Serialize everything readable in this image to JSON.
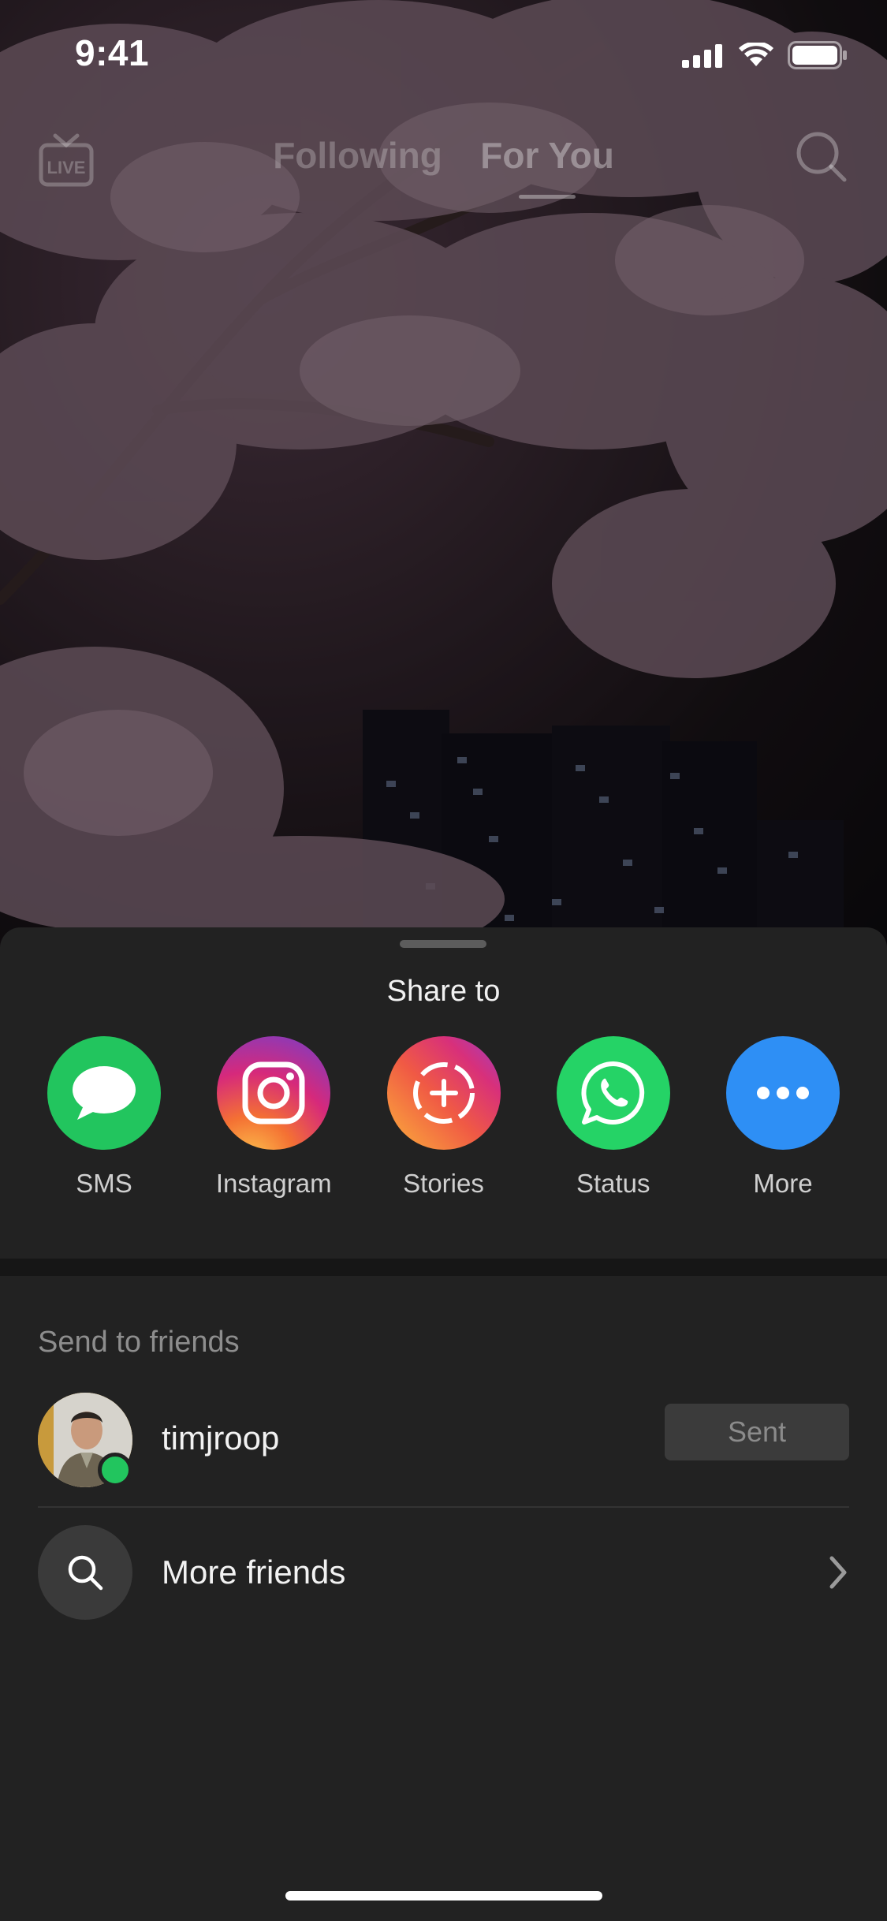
{
  "status_bar": {
    "time": "9:41"
  },
  "top_nav": {
    "live_label": "LIVE",
    "tabs": [
      {
        "label": "Following",
        "active": false
      },
      {
        "label": "For You",
        "active": true
      }
    ]
  },
  "share_sheet": {
    "title": "Share to",
    "targets": [
      {
        "label": "SMS",
        "icon": "message-bubble-icon",
        "color": "#22c55e"
      },
      {
        "label": "Instagram",
        "icon": "instagram-icon",
        "color": "#d6297b"
      },
      {
        "label": "Stories",
        "icon": "stories-add-icon",
        "color": "#e8425f"
      },
      {
        "label": "Status",
        "icon": "whatsapp-icon",
        "color": "#25d366"
      },
      {
        "label": "More",
        "icon": "ellipsis-icon",
        "color": "#2e8ff5"
      }
    ]
  },
  "friends": {
    "heading": "Send to friends",
    "list": [
      {
        "name": "timjroop",
        "online": true,
        "action_label": "Sent"
      }
    ],
    "more_label": "More friends"
  }
}
